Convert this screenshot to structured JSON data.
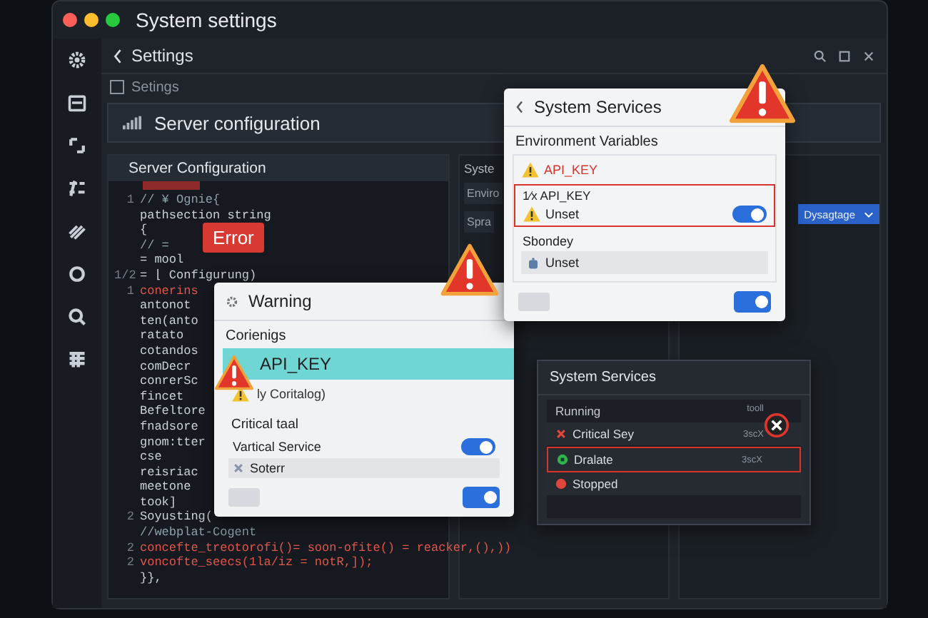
{
  "window": {
    "title": "System settings"
  },
  "header": {
    "title": "Settings"
  },
  "breadcrumb": {
    "label": "Setings",
    "checked": false
  },
  "section_bar": {
    "title": "Server configuration"
  },
  "editor": {
    "title": "Server Configuration",
    "tag": "Error",
    "lines": [
      {
        "number": "1",
        "text": "// ¥ Ognie{",
        "kind": "comment"
      },
      {
        "text": "pathsection string",
        "kind": "plain"
      },
      {
        "text": "{",
        "kind": "plain"
      },
      {
        "text": "// =",
        "kind": "comment"
      },
      {
        "text": "= mool",
        "kind": "plain"
      },
      {
        "number": "1/2",
        "text": "= ⌊ Configurung)",
        "kind": "plain"
      },
      {
        "number": "1",
        "text": "conerins",
        "kind": "keyword"
      },
      {
        "text": "antonot",
        "kind": "plain"
      },
      {
        "text": "ten(anto",
        "kind": "plain"
      },
      {
        "text": "ratato",
        "kind": "plain"
      },
      {
        "text": "cotandos",
        "kind": "plain"
      },
      {
        "text": "comDecr",
        "kind": "plain"
      },
      {
        "text": "conrerSc",
        "kind": "plain"
      },
      {
        "text": "fincet",
        "kind": "plain"
      },
      {
        "text": "Befeltore",
        "kind": "plain"
      },
      {
        "text": "fnadsore",
        "kind": "plain"
      },
      {
        "text": "gnom:tter",
        "kind": "plain"
      },
      {
        "text": "cse",
        "kind": "plain"
      },
      {
        "text": "reisriac",
        "kind": "plain"
      },
      {
        "text": "meetone",
        "kind": "plain"
      },
      {
        "text": "took]",
        "kind": "plain"
      },
      {
        "number": "2",
        "text": "Soyusting(",
        "kind": "plain"
      },
      {
        "text": "//webplat-Cogent",
        "kind": "comment"
      },
      {
        "number": "2",
        "text": "concefte_treotorofi()= soon-ofite() = reacker,(),))",
        "kind": "keyword"
      },
      {
        "number": "2",
        "text": "voncofte_seecs(1la/iz = notR,]);",
        "kind": "keyword"
      },
      {
        "text": "}},",
        "kind": "plain"
      }
    ]
  },
  "side_column": {
    "heading": "Syste",
    "rows": [
      "Enviro",
      "Spra"
    ],
    "dropdown": "Dysagtage"
  },
  "warning_dialog": {
    "title": "Warning",
    "section": "Corienigs",
    "highlight": "API_KEY",
    "note": "ly Coritalog)",
    "group": "Critical taal",
    "rows": [
      {
        "label": "Vartical Service",
        "kind": "toggle",
        "on": true
      },
      {
        "label": "Soterr",
        "kind": "error"
      }
    ],
    "footer_toggle": {
      "on": true
    }
  },
  "services_dialog": {
    "title": "System Services",
    "section": "Environment Variables",
    "error_item": "API_KEY",
    "selected_item": {
      "label": "1⁄x API_KEY",
      "status": "Unset",
      "on": true
    },
    "group": "Sbondey",
    "group_item": "Unset",
    "footer_toggle": {
      "on": true
    }
  },
  "services_panel": {
    "title": "System Services",
    "header": "Running",
    "header_meta": "tooll",
    "items": [
      {
        "label": "Critical Sey",
        "meta": "3scX",
        "kind": "error",
        "flagged": false
      },
      {
        "label": "Dralate",
        "meta": "3scX",
        "kind": "running",
        "flagged": true
      },
      {
        "label": "Stopped",
        "kind": "stopped",
        "flagged": false
      }
    ]
  }
}
